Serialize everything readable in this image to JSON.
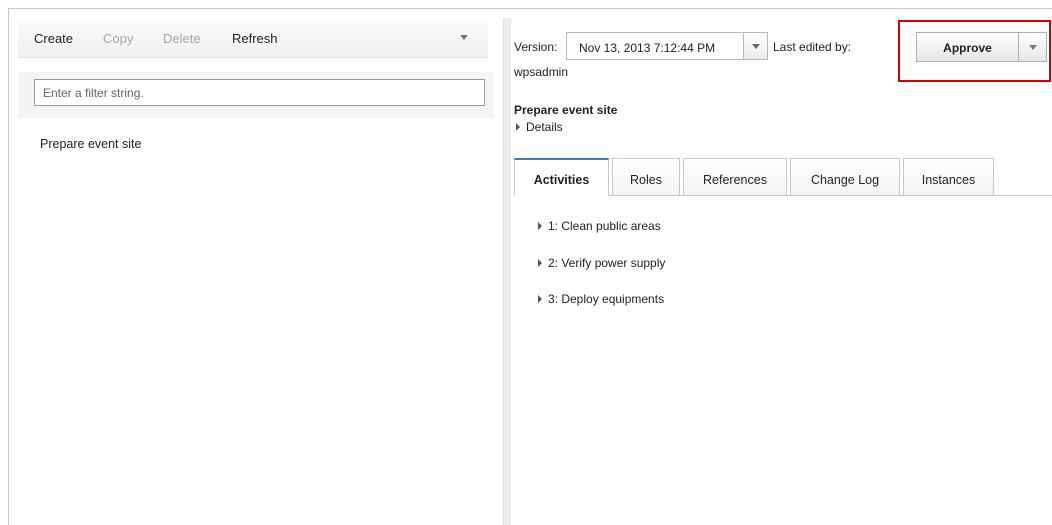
{
  "toolbar": {
    "create": "Create",
    "copy": "Copy",
    "delete": "Delete",
    "refresh": "Refresh"
  },
  "filter": {
    "placeholder": "Enter a filter string."
  },
  "tree": {
    "items": [
      "Prepare event site"
    ]
  },
  "header": {
    "version_label": "Version:",
    "version_value": "Nov 13, 2013 7:12:44 PM",
    "last_edited_label": "Last edited by:",
    "last_edited_user": "wpsadmin",
    "approve_label": "Approve"
  },
  "process": {
    "title": "Prepare event site",
    "details_label": "Details"
  },
  "tabs": [
    "Activities",
    "Roles",
    "References",
    "Change Log",
    "Instances"
  ],
  "active_tab": "Activities",
  "activities": [
    "1: Clean public areas",
    "2: Verify power supply",
    "3: Deploy equipments"
  ],
  "colors": {
    "highlight": "#d40000",
    "active_tab_accent": "#3a7cc0",
    "disabled_text": "#a5a5a5"
  }
}
